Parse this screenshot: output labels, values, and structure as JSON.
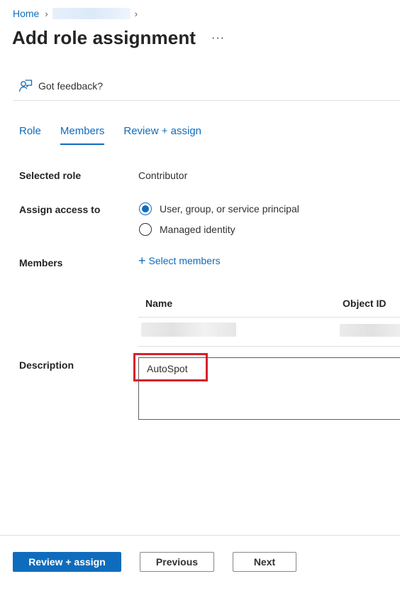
{
  "breadcrumb": {
    "home": "Home",
    "separator": "›"
  },
  "header": {
    "title": "Add role assignment",
    "more": "···"
  },
  "feedback": {
    "label": "Got feedback?"
  },
  "tabs": [
    {
      "label": "Role",
      "active": false
    },
    {
      "label": "Members",
      "active": true
    },
    {
      "label": "Review + assign",
      "active": false
    }
  ],
  "form": {
    "selected_role": {
      "label": "Selected role",
      "value": "Contributor"
    },
    "assign_access": {
      "label": "Assign access to",
      "options": [
        {
          "label": "User, group, or service principal",
          "checked": true
        },
        {
          "label": "Managed identity",
          "checked": false
        }
      ]
    },
    "members": {
      "label": "Members",
      "select_label": "Select members",
      "columns": [
        "Name",
        "Object ID"
      ]
    },
    "description": {
      "label": "Description",
      "value": "AutoSpot"
    }
  },
  "footer": {
    "review_assign": "Review + assign",
    "previous": "Previous",
    "next": "Next"
  },
  "colors": {
    "accent": "#0f6cbd",
    "highlight": "#d6212b"
  }
}
